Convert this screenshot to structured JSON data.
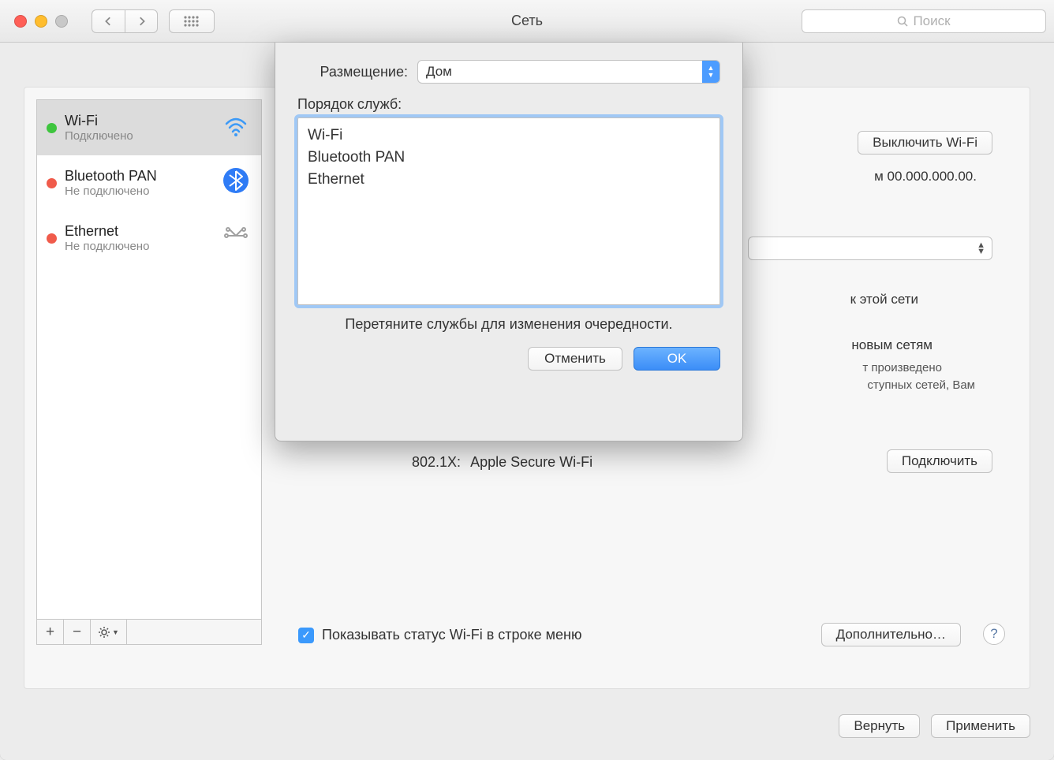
{
  "window": {
    "title": "Сеть"
  },
  "toolbar": {
    "search_placeholder": "Поиск"
  },
  "sidebar": {
    "services": [
      {
        "name": "Wi-Fi",
        "status": "Подключено",
        "dot": "green",
        "icon": "wifi",
        "selected": true
      },
      {
        "name": "Bluetooth PAN",
        "status": "Не подключено",
        "dot": "red",
        "icon": "bluetooth",
        "selected": false
      },
      {
        "name": "Ethernet",
        "status": "Не подключено",
        "dot": "red",
        "icon": "ethernet",
        "selected": false
      }
    ]
  },
  "right": {
    "turn_off": "Выключить Wi-Fi",
    "ip_suffix": "м 00.000.000.00.",
    "line1": "к этой сети",
    "line2": "новым сетям",
    "line3a": "т произведено",
    "line3b": "ступных сетей, Вам",
    "label_8021x": "802.1X:",
    "wifi_name": "Apple Secure Wi-Fi",
    "connect": "Подключить",
    "show_status": "Показывать статус Wi-Fi в строке меню",
    "advanced": "Дополнительно…"
  },
  "footer": {
    "revert": "Вернуть",
    "apply": "Применить"
  },
  "modal": {
    "location_label": "Размещение:",
    "location_value": "Дом",
    "order_label": "Порядок служб:",
    "items": [
      "Wi-Fi",
      "Bluetooth PAN",
      "Ethernet"
    ],
    "hint": "Перетяните службы для изменения очередности.",
    "cancel": "Отменить",
    "ok": "OK"
  }
}
